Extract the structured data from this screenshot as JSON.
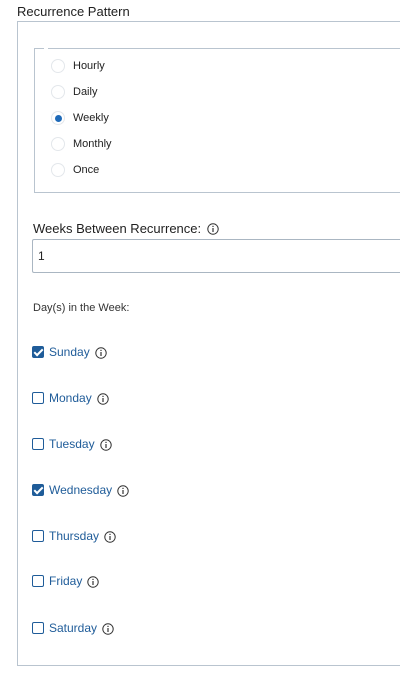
{
  "section": {
    "title": "Recurrence Pattern"
  },
  "pattern": {
    "options": [
      {
        "label": "Hourly",
        "checked": false
      },
      {
        "label": "Daily",
        "checked": false
      },
      {
        "label": "Weekly",
        "checked": true
      },
      {
        "label": "Monthly",
        "checked": false
      },
      {
        "label": "Once",
        "checked": false
      }
    ]
  },
  "weeks": {
    "label": "Weeks Between Recurrence:",
    "value": "1"
  },
  "days": {
    "label": "Day(s) in the Week:",
    "items": [
      {
        "label": "Sunday",
        "checked": true
      },
      {
        "label": "Monday",
        "checked": false
      },
      {
        "label": "Tuesday",
        "checked": false
      },
      {
        "label": "Wednesday",
        "checked": true
      },
      {
        "label": "Thursday",
        "checked": false
      },
      {
        "label": "Friday",
        "checked": false
      },
      {
        "label": "Saturday",
        "checked": false
      }
    ]
  },
  "colors": {
    "accent": "#1f5c99",
    "radio_accent": "#1f6ab8",
    "border": "#b9c4cf"
  },
  "icons": {
    "info": "info-icon"
  }
}
